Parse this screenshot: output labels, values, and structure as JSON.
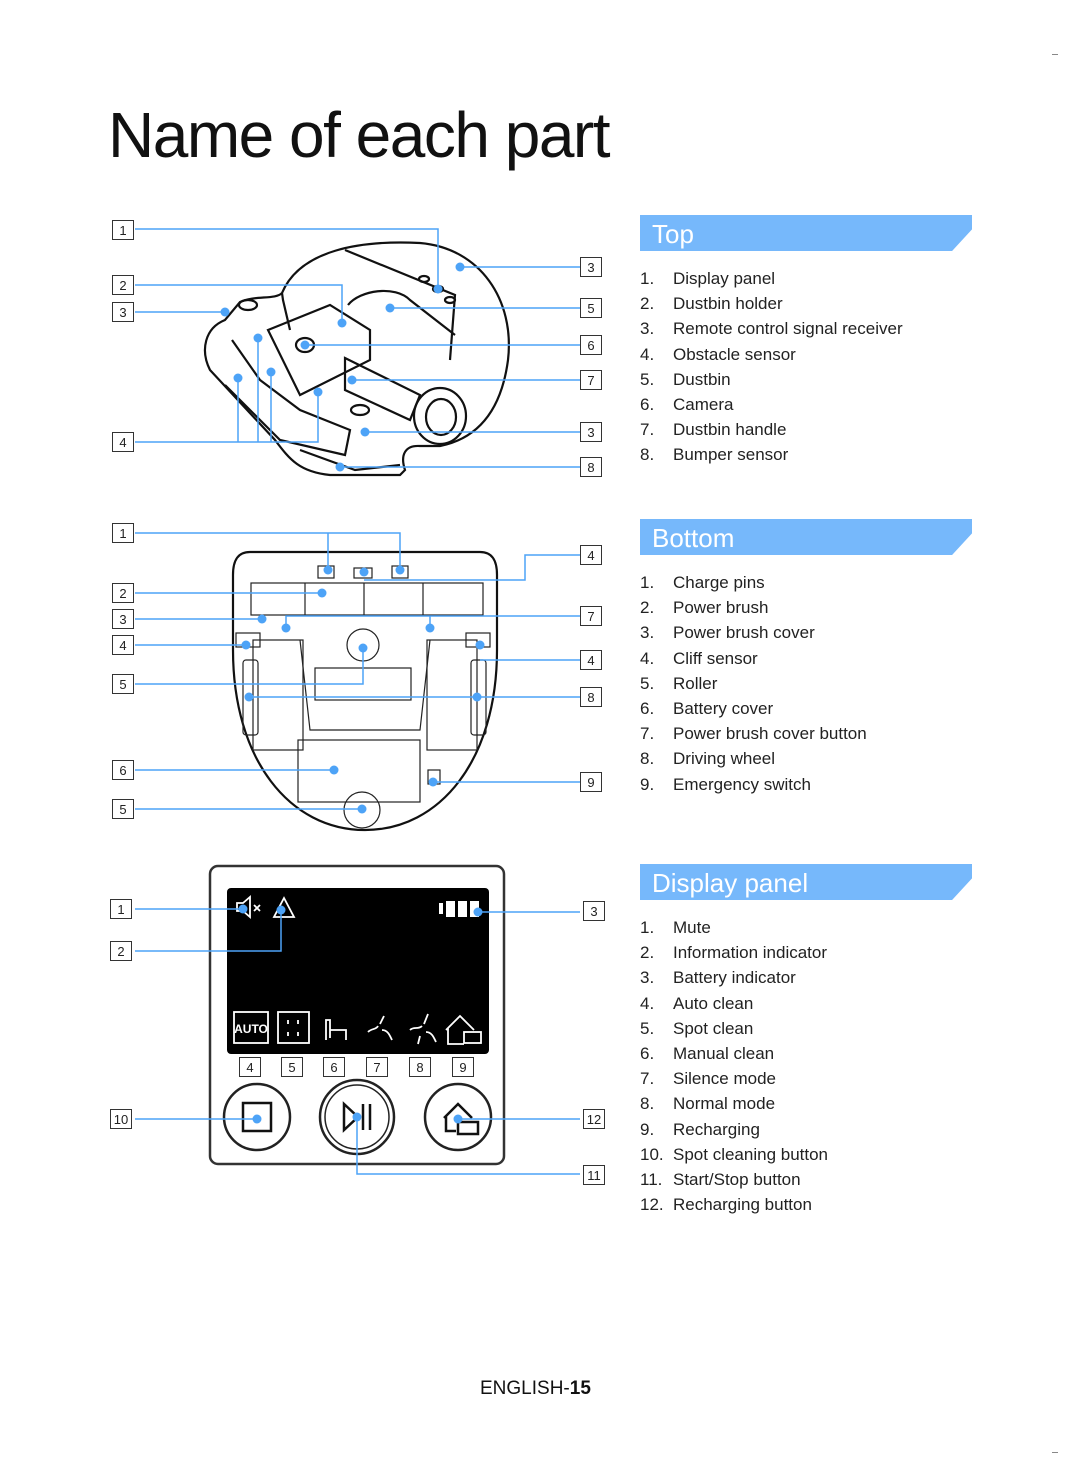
{
  "page_title": "Name of each part",
  "footer": {
    "prefix": "ENGLISH-",
    "page": "15"
  },
  "accent_color": "#76b8fb",
  "leader_color": "#4da3f7",
  "sections": {
    "top": {
      "header": "Top",
      "items": [
        {
          "num": "1.",
          "label": "Display panel"
        },
        {
          "num": "2.",
          "label": "Dustbin holder"
        },
        {
          "num": "3.",
          "label": "Remote control signal receiver"
        },
        {
          "num": "4.",
          "label": "Obstacle sensor"
        },
        {
          "num": "5.",
          "label": "Dustbin"
        },
        {
          "num": "6.",
          "label": "Camera"
        },
        {
          "num": "7.",
          "label": "Dustbin handle"
        },
        {
          "num": "8.",
          "label": "Bumper sensor"
        }
      ],
      "callouts_left": [
        "1",
        "2",
        "3",
        "4"
      ],
      "callouts_right": [
        "3",
        "5",
        "6",
        "7",
        "3",
        "8"
      ]
    },
    "bottom": {
      "header": "Bottom",
      "items": [
        {
          "num": "1.",
          "label": "Charge pins"
        },
        {
          "num": "2.",
          "label": "Power brush"
        },
        {
          "num": "3.",
          "label": "Power brush cover"
        },
        {
          "num": "4.",
          "label": "Cliff sensor"
        },
        {
          "num": "5.",
          "label": "Roller"
        },
        {
          "num": "6.",
          "label": "Battery cover"
        },
        {
          "num": "7.",
          "label": "Power brush cover button"
        },
        {
          "num": "8.",
          "label": "Driving wheel"
        },
        {
          "num": "9.",
          "label": "Emergency switch"
        }
      ],
      "callouts_left": [
        "1",
        "2",
        "3",
        "4",
        "5",
        "6",
        "5"
      ],
      "callouts_right": [
        "4",
        "7",
        "4",
        "8",
        "9"
      ]
    },
    "display_panel": {
      "header": "Display panel",
      "items": [
        {
          "num": "1.",
          "label": "Mute"
        },
        {
          "num": "2.",
          "label": "Information indicator"
        },
        {
          "num": "3.",
          "label": "Battery indicator"
        },
        {
          "num": "4.",
          "label": "Auto clean"
        },
        {
          "num": "5.",
          "label": "Spot clean"
        },
        {
          "num": "6.",
          "label": "Manual clean"
        },
        {
          "num": "7.",
          "label": "Silence mode"
        },
        {
          "num": "8.",
          "label": "Normal mode"
        },
        {
          "num": "9.",
          "label": "Recharging"
        },
        {
          "num": "10.",
          "label": "Spot cleaning button"
        },
        {
          "num": "11.",
          "label": "Start/Stop button"
        },
        {
          "num": "12.",
          "label": "Recharging button"
        }
      ],
      "screen_auto_label": "AUTO",
      "callouts_left": [
        "1",
        "2",
        "10"
      ],
      "callouts_right": [
        "3",
        "12",
        "11"
      ],
      "callouts_under_screen": [
        "4",
        "5",
        "6",
        "7",
        "8",
        "9"
      ]
    }
  }
}
